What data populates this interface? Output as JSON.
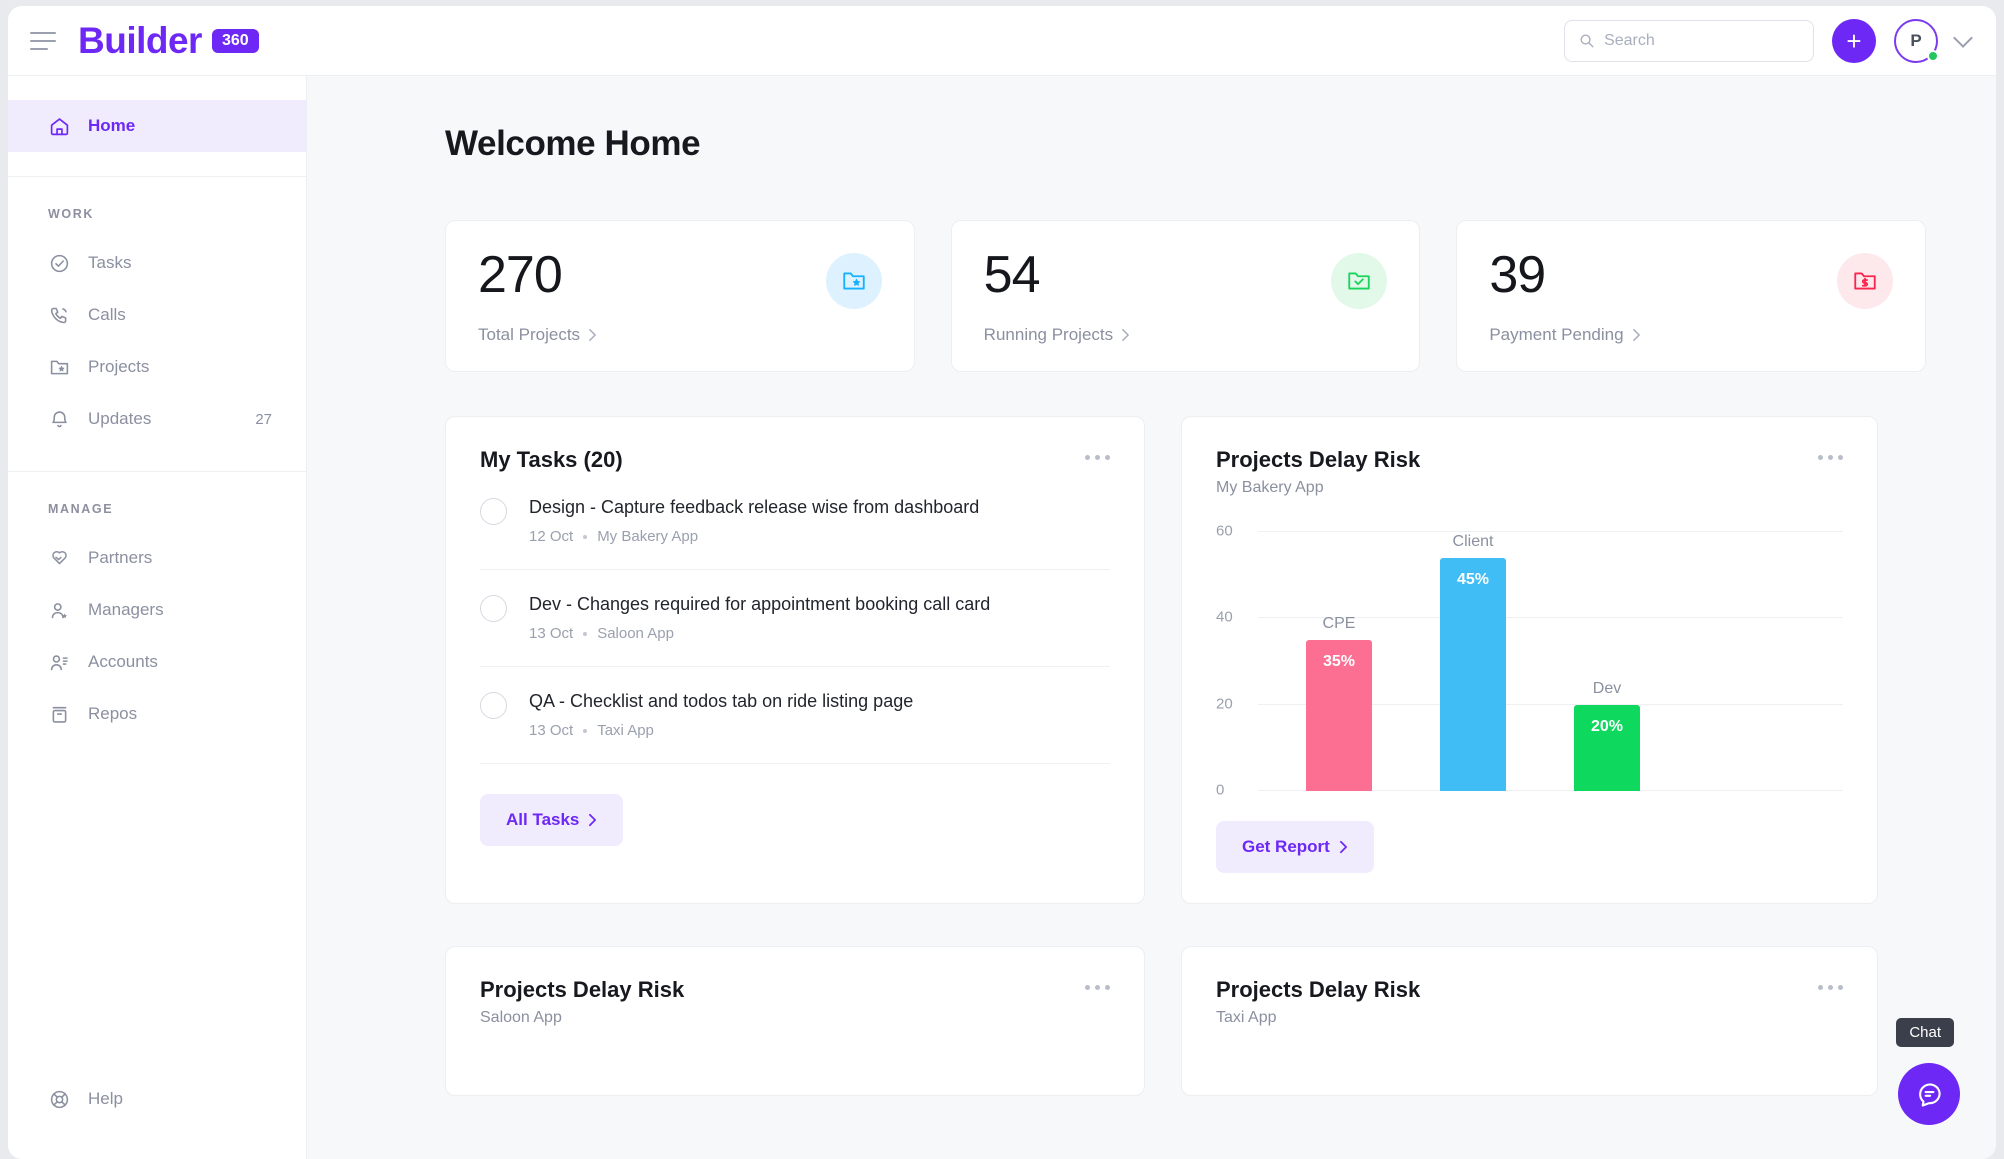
{
  "header": {
    "logo_text": "Builder",
    "logo_badge": "360",
    "search_placeholder": "Search",
    "search_value": "",
    "add_label": "+",
    "avatar_initial": "P"
  },
  "sidebar": {
    "home": {
      "label": "Home",
      "icon": "home-icon"
    },
    "work_label": "WORK",
    "work_items": [
      {
        "label": "Tasks",
        "icon": "check-circle-icon",
        "badge": ""
      },
      {
        "label": "Calls",
        "icon": "phone-icon",
        "badge": ""
      },
      {
        "label": "Projects",
        "icon": "folder-star-icon",
        "badge": ""
      },
      {
        "label": "Updates",
        "icon": "bell-icon",
        "badge": "27"
      }
    ],
    "manage_label": "MANAGE",
    "manage_items": [
      {
        "label": "Partners",
        "icon": "handshake-icon"
      },
      {
        "label": "Managers",
        "icon": "user-star-icon"
      },
      {
        "label": "Accounts",
        "icon": "user-list-icon"
      },
      {
        "label": "Repos",
        "icon": "archive-icon"
      }
    ],
    "help": {
      "label": "Help",
      "icon": "lifebuoy-icon"
    }
  },
  "main": {
    "page_title": "Welcome Home",
    "stats": [
      {
        "value": "270",
        "label": "Total Projects",
        "icon": "folder-star-icon",
        "color": "#16b1ff",
        "bg": "#ddf2fe"
      },
      {
        "value": "54",
        "label": "Running Projects",
        "icon": "folder-check-icon",
        "color": "#19d45c",
        "bg": "#e2f9ea"
      },
      {
        "value": "39",
        "label": "Payment Pending",
        "icon": "folder-dollar-icon",
        "color": "#fa254f",
        "bg": "#fde8ec"
      }
    ],
    "tasks_panel": {
      "title": "My Tasks (20)",
      "menu_icon": "more-horizontal-icon",
      "tasks": [
        {
          "title": "Design - Capture feedback release wise from dashboard",
          "date": "12 Oct",
          "project": "My Bakery App"
        },
        {
          "title": "Dev - Changes required for appointment booking call card",
          "date": "13 Oct",
          "project": "Saloon App"
        },
        {
          "title": "QA - Checklist and todos tab on ride listing page",
          "date": "13 Oct",
          "project": "Taxi App"
        }
      ],
      "all_tasks_label": "All Tasks"
    },
    "risk_panel": {
      "title": "Projects Delay Risk",
      "subtitle": "My Bakery App",
      "menu_icon": "more-horizontal-icon",
      "get_report_label": "Get Report"
    },
    "bottom_panels": [
      {
        "title": "Projects Delay Risk",
        "subtitle": "Saloon App",
        "menu_icon": "more-horizontal-icon"
      },
      {
        "title": "Projects Delay Risk",
        "subtitle": "Taxi App",
        "menu_icon": "more-horizontal-icon"
      }
    ],
    "chat": {
      "tooltip": "Chat",
      "icon": "chat-bubble-icon"
    }
  },
  "chart_data": {
    "type": "bar",
    "title": "Projects Delay Risk",
    "subtitle": "My Bakery App",
    "categories": [
      "CPE",
      "Client",
      "Dev"
    ],
    "values": [
      35,
      54,
      20
    ],
    "data_labels": [
      "35%",
      "45%",
      "20%"
    ],
    "colors": [
      "#fc6f92",
      "#41bdf5",
      "#0fd85f"
    ],
    "yticks": [
      0,
      20,
      40,
      60
    ],
    "ylim": [
      0,
      60
    ],
    "xlabel": "",
    "ylabel": "",
    "grid": true,
    "legend": "none"
  },
  "theme": {
    "accent": "#6d28f5",
    "accent_soft": "#f1ebfe",
    "text_dark": "#17191f",
    "text_muted": "#8b90a0"
  }
}
